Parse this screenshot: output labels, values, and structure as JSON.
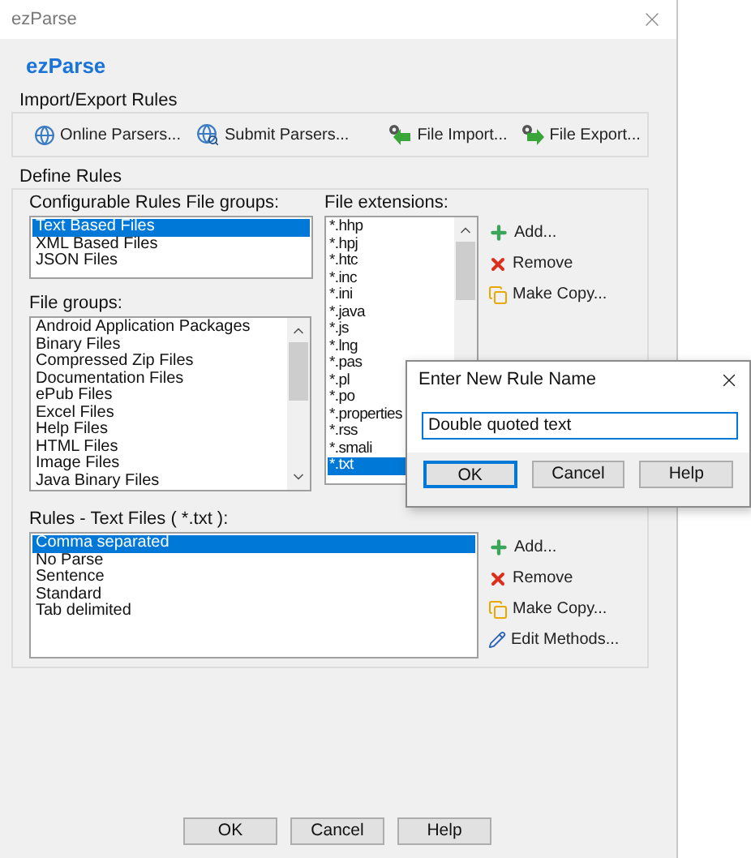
{
  "window": {
    "title": "ezParse"
  },
  "heading": "ezParse",
  "import_export": {
    "label": "Import/Export Rules",
    "buttons": [
      {
        "kind": "globe",
        "label": "Online Parsers..."
      },
      {
        "kind": "globe-search",
        "label": "Submit Parsers..."
      },
      {
        "kind": "import",
        "label": "File Import..."
      },
      {
        "kind": "export",
        "label": "File Export..."
      }
    ]
  },
  "define_rules": {
    "label": "Define Rules",
    "configurable_groups": {
      "label": "Configurable Rules File groups:",
      "items": [
        {
          "label": "Text Based Files",
          "selected": true
        },
        {
          "label": "XML Based Files",
          "selected": false
        },
        {
          "label": "JSON Files",
          "selected": false
        }
      ]
    },
    "file_groups": {
      "label": "File groups:",
      "items": [
        {
          "label": "Android Application Packages",
          "selected": false
        },
        {
          "label": "Binary Files",
          "selected": false
        },
        {
          "label": "Compressed Zip Files",
          "selected": false
        },
        {
          "label": "Documentation Files",
          "selected": false
        },
        {
          "label": "ePub Files",
          "selected": false
        },
        {
          "label": "Excel Files",
          "selected": false
        },
        {
          "label": "Help Files",
          "selected": false
        },
        {
          "label": "HTML Files",
          "selected": false
        },
        {
          "label": "Image Files",
          "selected": false
        },
        {
          "label": "Java Binary Files",
          "selected": false
        }
      ]
    },
    "file_extensions": {
      "label": "File extensions:",
      "items": [
        {
          "label": "*.hhp",
          "selected": false
        },
        {
          "label": "*.hpj",
          "selected": false
        },
        {
          "label": "*.htc",
          "selected": false
        },
        {
          "label": "*.inc",
          "selected": false
        },
        {
          "label": "*.ini",
          "selected": false
        },
        {
          "label": "*.java",
          "selected": false
        },
        {
          "label": "*.js",
          "selected": false
        },
        {
          "label": "*.lng",
          "selected": false
        },
        {
          "label": "*.pas",
          "selected": false
        },
        {
          "label": "*.pl",
          "selected": false
        },
        {
          "label": "*.po",
          "selected": false
        },
        {
          "label": "*.properties",
          "selected": false
        },
        {
          "label": "*.rss",
          "selected": false
        },
        {
          "label": "*.smali",
          "selected": false
        },
        {
          "label": "*.txt",
          "selected": true
        }
      ]
    },
    "extension_actions": [
      {
        "kind": "add",
        "label": "Add..."
      },
      {
        "kind": "remove",
        "label": "Remove"
      },
      {
        "kind": "copy",
        "label": "Make Copy..."
      }
    ],
    "rules": {
      "label": "Rules - Text Files ( *.txt ):",
      "items": [
        {
          "label": "Comma separated",
          "selected": true
        },
        {
          "label": "No Parse",
          "selected": false
        },
        {
          "label": "Sentence",
          "selected": false
        },
        {
          "label": "Standard",
          "selected": false
        },
        {
          "label": "Tab delimited",
          "selected": false
        }
      ]
    },
    "rule_actions": [
      {
        "kind": "add",
        "label": "Add..."
      },
      {
        "kind": "remove",
        "label": "Remove"
      },
      {
        "kind": "copy",
        "label": "Make Copy..."
      },
      {
        "kind": "edit",
        "label": "Edit Methods..."
      }
    ]
  },
  "buttons": [
    {
      "label": "OK"
    },
    {
      "label": "Cancel"
    },
    {
      "label": "Help"
    }
  ],
  "dialog": {
    "title": "Enter New Rule Name",
    "value": "Double quoted text",
    "buttons": [
      {
        "label": "OK",
        "default": true
      },
      {
        "label": "Cancel",
        "default": false
      },
      {
        "label": "Help",
        "default": false
      }
    ]
  }
}
